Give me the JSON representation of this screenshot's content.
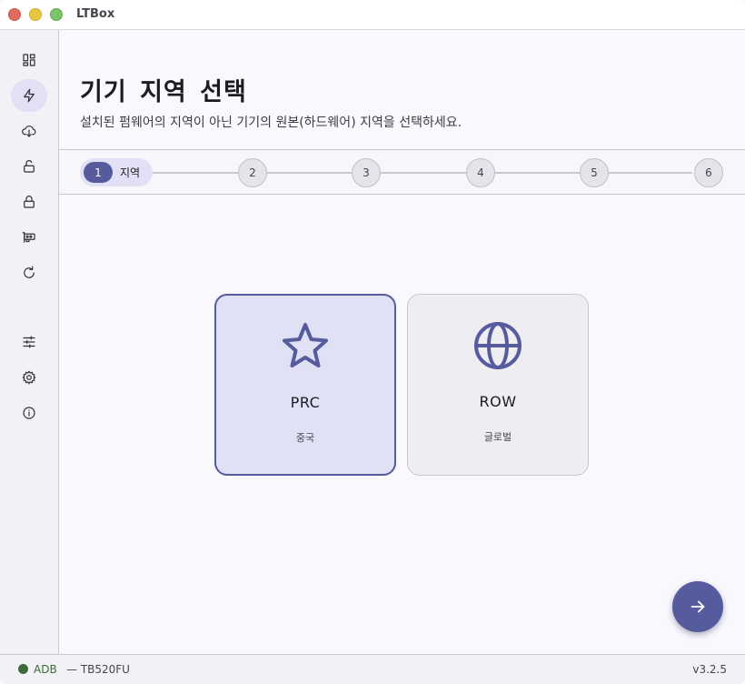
{
  "window": {
    "title": "LTBox"
  },
  "sidebar": {
    "items": [
      {
        "icon": "dashboard-icon",
        "active": false
      },
      {
        "icon": "flash-icon",
        "active": true
      },
      {
        "icon": "cloud-download-icon",
        "active": false
      },
      {
        "icon": "unlock-icon",
        "active": false
      },
      {
        "icon": "lock-icon",
        "active": false
      },
      {
        "icon": "chip-icon",
        "active": false
      },
      {
        "icon": "refresh-icon",
        "active": false
      },
      {
        "icon": "tune-icon",
        "active": false
      },
      {
        "icon": "gear-icon",
        "active": false
      },
      {
        "icon": "info-icon",
        "active": false
      }
    ]
  },
  "main": {
    "title": "기기 지역 선택",
    "subtitle": "설치된 펌웨어의 지역이 아닌 기기의 원본(하드웨어) 지역을 선택하세요."
  },
  "stepper": {
    "active_step": {
      "number": "1",
      "label": "지역"
    },
    "steps": [
      "2",
      "3",
      "4",
      "5",
      "6"
    ]
  },
  "cards": {
    "prc": {
      "title": "PRC",
      "subtitle": "중국",
      "icon": "star-icon",
      "selected": true
    },
    "row": {
      "title": "ROW",
      "subtitle": "글로벌",
      "icon": "globe-icon",
      "selected": false
    }
  },
  "fab": {
    "icon": "arrow-right-icon"
  },
  "status": {
    "connection": "ADB",
    "device": "— TB520FU",
    "version": "v3.2.5"
  },
  "colors": {
    "accent": "#565b9d",
    "accent_light": "#e1e0f5",
    "connected": "#3e6a3a"
  }
}
